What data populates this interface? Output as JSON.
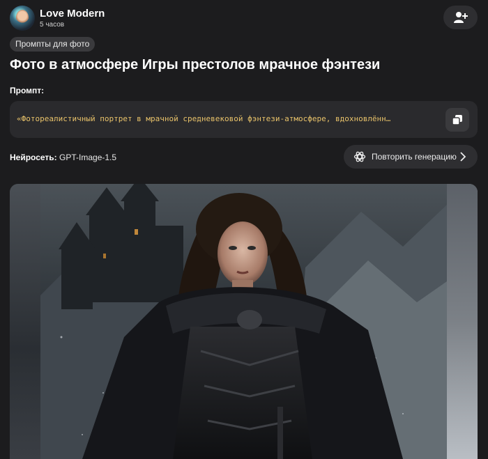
{
  "author": {
    "name": "Love Modern",
    "time": "5 часов"
  },
  "tag": "Промпты для фото",
  "title": "Фото в атмосфере Игры престолов мрачное фэнтези",
  "prompt": {
    "label": "Промпт:",
    "text": "«Фотореалистичный портрет в мрачной средневековой фэнтези-атмосфере, вдохновлённ…"
  },
  "model": {
    "label": "Нейросеть:",
    "value": "GPT-Image-1.5"
  },
  "regenerate": {
    "label": "Повторить генерацию"
  },
  "icons": {
    "follow": "add-user-icon",
    "copy": "copy-icon",
    "regenerate": "openai-icon",
    "chevron": "chevron-right-icon"
  },
  "colors": {
    "background": "#1c1c1e",
    "prompt_text": "#e8c26a",
    "button_bg": "#2e2e31"
  }
}
